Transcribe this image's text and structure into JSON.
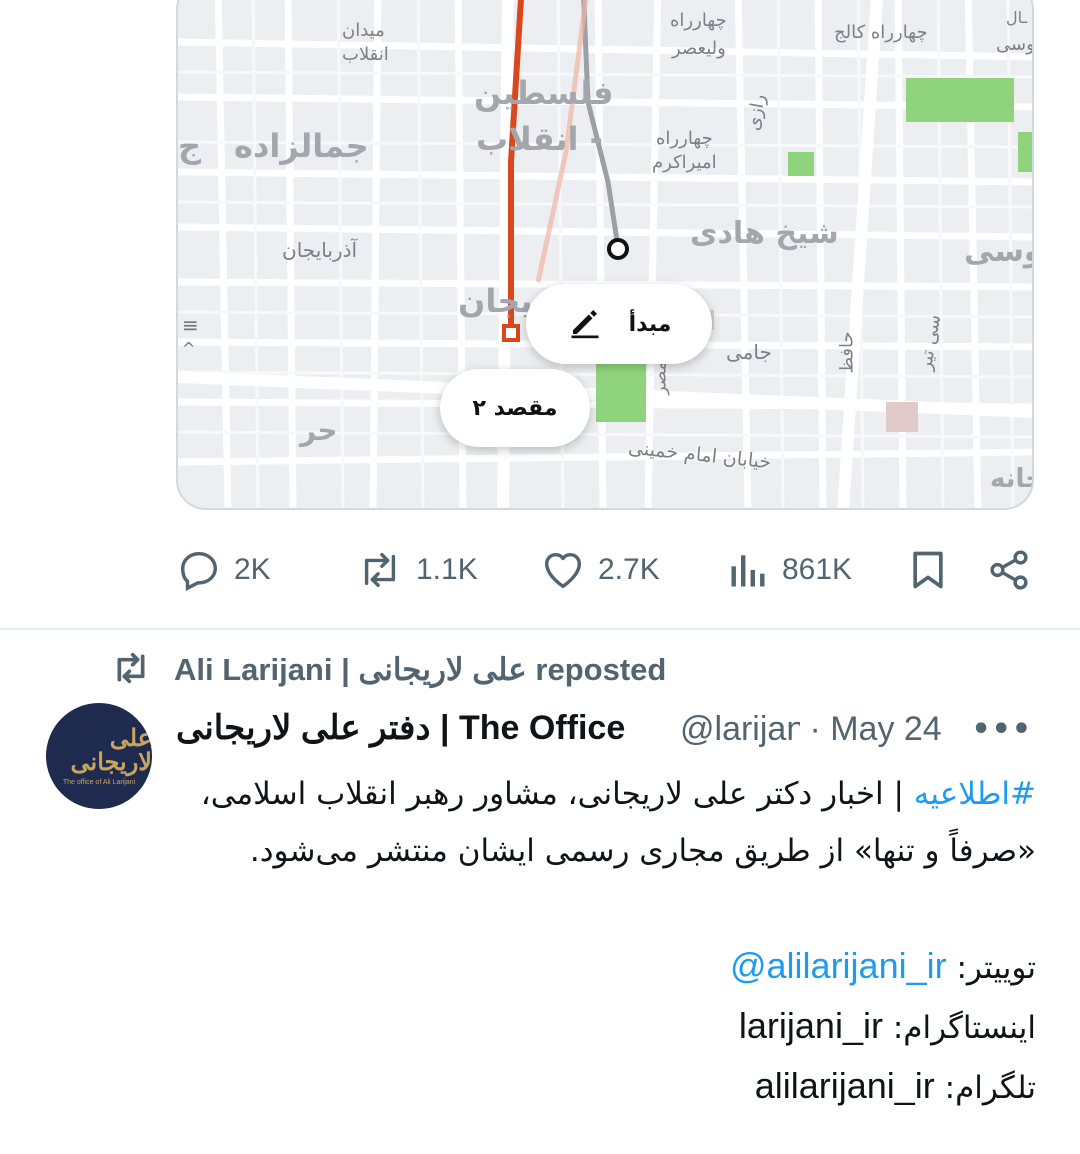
{
  "map": {
    "labels": {
      "meydan_enghelab_1": "میدان",
      "meydan_enghelab_2": "انقلاب",
      "jamalzadeh": "جمالزاده",
      "jamalzadeh_cut": "ج",
      "felestin_1": "فلسطین",
      "felestin_2": "- انقلاب",
      "chaharrah_valiasr_1": "چهارراه",
      "chaharrah_valiasr_2": "ولیعصر",
      "chaharrah_college": "چهارراه کالج",
      "vesal_top_1": "ـال",
      "vesal_top_2": "وسی",
      "razi": "رازی",
      "chaharrah_amir_1": "چهارراه",
      "chaharrah_amir_2": "امیراکرم",
      "azarbaijan": "آذربایجان",
      "azarbaijan_big": "یجان",
      "sheikh_hadi": "شیخ هادی",
      "vesal_right": "وسی",
      "jami": "جامی",
      "hafez": "حافظ",
      "si_tir": "سی تیر",
      "hor": "حر",
      "khomeini_street": "خیابان امام خمینی",
      "mosaddegh_cut": "مصر",
      "khaneh_cut": "خانه"
    },
    "origin_label": "مبدأ",
    "destination_label": "مقصد ۲",
    "colors": {
      "route": "#d9481c",
      "alt_route": "#9aa0a6",
      "park": "#8fd47c"
    }
  },
  "actions": {
    "replies": "2K",
    "reposts": "1.1K",
    "likes": "2.7K",
    "views": "861K"
  },
  "repost": {
    "text": "Ali Larijani | علی لاریجانی reposted"
  },
  "tweet": {
    "avatar_text": "علی لاریجانی",
    "avatar_subtext": "The office of Ali Larijani",
    "display_name": "دفتر علی لاریجانی | The Office",
    "handle": "@larijani_ir",
    "separator": " · ",
    "date": "May 24",
    "more": "•••",
    "hashtag": "#اطلاعیه",
    "line1_rest": " | اخبار دکتر علی لاریجانی، مشاور رهبر انقلاب اسلامی، «صرفاً و تنها» از طریق مجاری رسمی ایشان منتشر می‌شود.",
    "twitter_label": "توییتر: ",
    "twitter_value": "@alilarijani_ir",
    "instagram_label": "اینستاگرام: ",
    "instagram_value": "larijani_ir",
    "telegram_label": "تلگرام: ",
    "telegram_value": "alilarijani_ir"
  }
}
